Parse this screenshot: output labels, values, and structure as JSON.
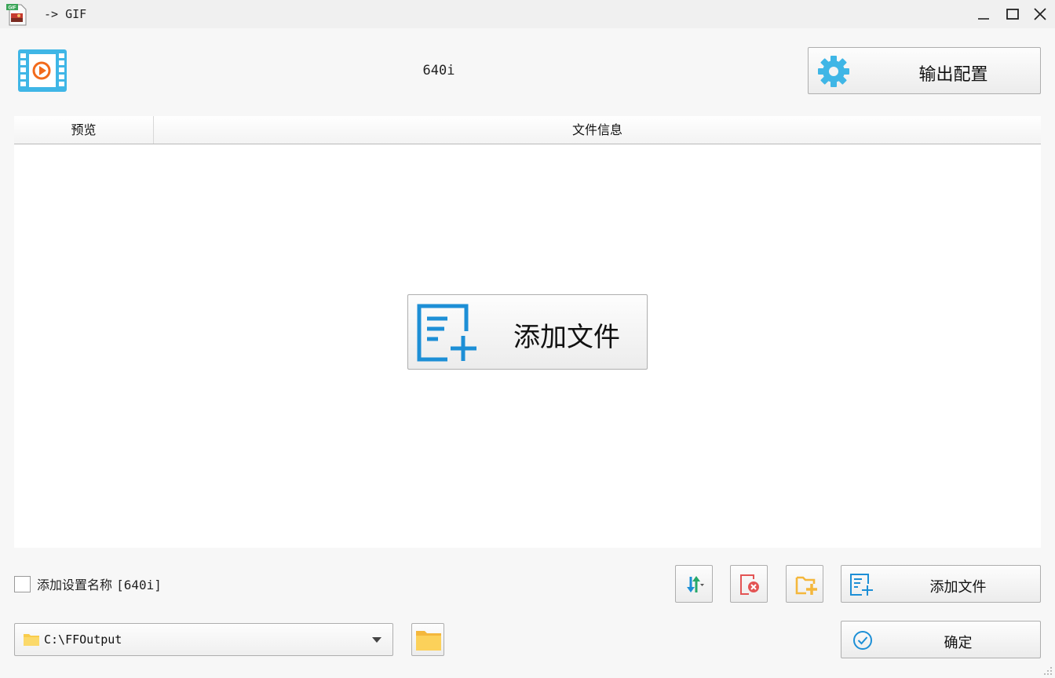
{
  "window": {
    "title": "-> GIF",
    "app_icon": "gif-file-icon",
    "controls": [
      "minimize-icon",
      "maximize-icon",
      "close-icon"
    ]
  },
  "header": {
    "logo_icon": "video-film-icon",
    "preset_name": "640i",
    "output_config_label": "输出配置",
    "output_config_icon": "gear-icon"
  },
  "file_table": {
    "columns": [
      "预览",
      "文件信息"
    ],
    "rows": [],
    "add_file_label": "添加文件",
    "add_file_icon": "add-file-icon"
  },
  "options": {
    "add_setting_name_label": "添加设置名称",
    "add_setting_name_value": "[640i]",
    "add_setting_name_checked": false
  },
  "toolbar": {
    "sort_icon": "sort-arrows-icon",
    "clear_icon": "clear-list-icon",
    "add_folder_icon": "add-folder-icon",
    "add_file_label": "添加文件",
    "add_file_icon": "add-file-icon"
  },
  "output": {
    "folder_path": "C:\\FFOutput",
    "folder_icon": "folder-icon",
    "browse_icon": "folder-icon"
  },
  "confirm": {
    "label": "确定",
    "icon": "check-circle-icon"
  },
  "colors": {
    "accent_blue": "#1d8fd6",
    "logo_cyan": "#3fb6e6",
    "play_orange": "#f26a1b",
    "clear_red": "#e35454",
    "folder_yellow": "#f4c23c",
    "sort_green": "#27a86b"
  }
}
